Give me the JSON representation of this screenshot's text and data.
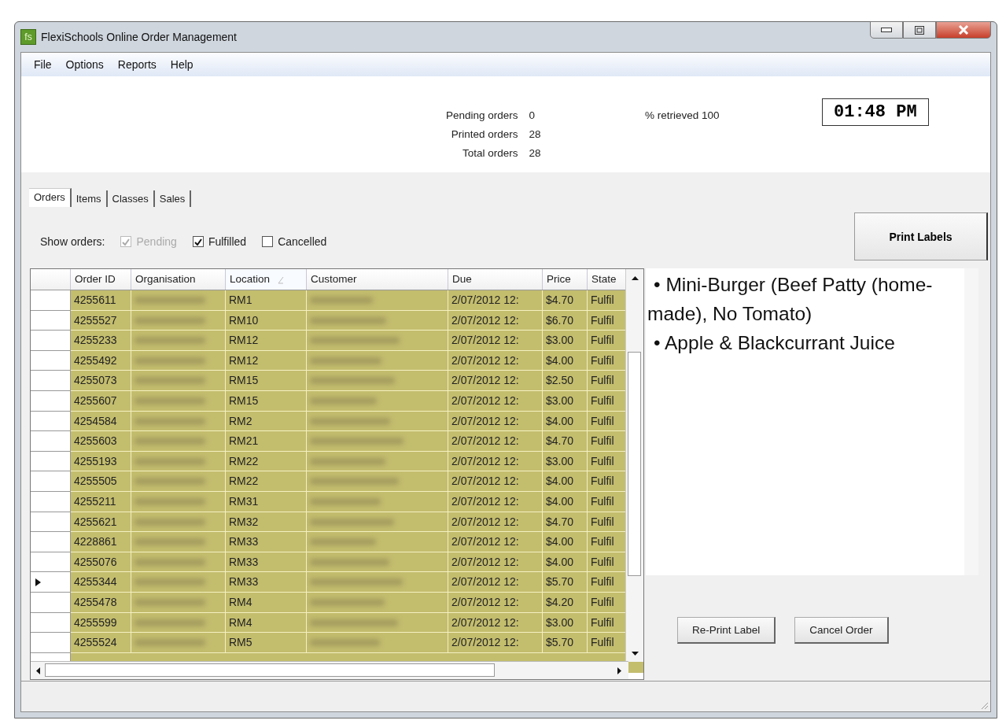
{
  "window": {
    "title": "FlexiSchools Online Order Management",
    "app_icon": "fs"
  },
  "menu": [
    "File",
    "Options",
    "Reports",
    "Help"
  ],
  "stats": [
    {
      "label": "Pending orders",
      "value": "0"
    },
    {
      "label": "Printed orders",
      "value": "28"
    },
    {
      "label": "Total orders",
      "value": "28"
    }
  ],
  "retrieved": "% retrieved 100",
  "clock": "01:48 PM",
  "tabs": [
    {
      "label": "Orders",
      "selected": true
    },
    {
      "label": "Items",
      "selected": false
    },
    {
      "label": "Classes",
      "selected": false
    },
    {
      "label": "Sales",
      "selected": false
    }
  ],
  "filter": {
    "label": "Show orders:",
    "options": [
      {
        "label": "Pending",
        "checked": true,
        "disabled": true
      },
      {
        "label": "Fulfilled",
        "checked": true,
        "disabled": false
      },
      {
        "label": "Cancelled",
        "checked": false,
        "disabled": false
      }
    ]
  },
  "print_button": "Print Labels",
  "grid": {
    "columns": [
      {
        "label": "Order ID",
        "sorted": false
      },
      {
        "label": "Organisation",
        "sorted": false
      },
      {
        "label": "Location",
        "sorted": true
      },
      {
        "label": "Customer",
        "sorted": false
      },
      {
        "label": "Due",
        "sorted": false
      },
      {
        "label": "Price",
        "sorted": false
      },
      {
        "label": "State",
        "sorted": false
      }
    ],
    "rows": [
      {
        "order_id": "4255611",
        "location": "RM1",
        "due": "2/07/2012 12:",
        "price": "$4.70",
        "state": "Fulfil",
        "selected": false
      },
      {
        "order_id": "4255527",
        "location": "RM10",
        "due": "2/07/2012 12:",
        "price": "$6.70",
        "state": "Fulfil",
        "selected": false
      },
      {
        "order_id": "4255233",
        "location": "RM12",
        "due": "2/07/2012 12:",
        "price": "$3.00",
        "state": "Fulfil",
        "selected": false
      },
      {
        "order_id": "4255492",
        "location": "RM12",
        "due": "2/07/2012 12:",
        "price": "$4.00",
        "state": "Fulfil",
        "selected": false
      },
      {
        "order_id": "4255073",
        "location": "RM15",
        "due": "2/07/2012 12:",
        "price": "$2.50",
        "state": "Fulfil",
        "selected": false
      },
      {
        "order_id": "4255607",
        "location": "RM15",
        "due": "2/07/2012 12:",
        "price": "$3.00",
        "state": "Fulfil",
        "selected": false
      },
      {
        "order_id": "4254584",
        "location": "RM2",
        "due": "2/07/2012 12:",
        "price": "$4.00",
        "state": "Fulfil",
        "selected": false
      },
      {
        "order_id": "4255603",
        "location": "RM21",
        "due": "2/07/2012 12:",
        "price": "$4.70",
        "state": "Fulfil",
        "selected": false
      },
      {
        "order_id": "4255193",
        "location": "RM22",
        "due": "2/07/2012 12:",
        "price": "$3.00",
        "state": "Fulfil",
        "selected": false
      },
      {
        "order_id": "4255505",
        "location": "RM22",
        "due": "2/07/2012 12:",
        "price": "$4.00",
        "state": "Fulfil",
        "selected": false
      },
      {
        "order_id": "4255211",
        "location": "RM31",
        "due": "2/07/2012 12:",
        "price": "$4.00",
        "state": "Fulfil",
        "selected": false
      },
      {
        "order_id": "4255621",
        "location": "RM32",
        "due": "2/07/2012 12:",
        "price": "$4.70",
        "state": "Fulfil",
        "selected": false
      },
      {
        "order_id": "4228861",
        "location": "RM33",
        "due": "2/07/2012 12:",
        "price": "$4.00",
        "state": "Fulfil",
        "selected": false
      },
      {
        "order_id": "4255076",
        "location": "RM33",
        "due": "2/07/2012 12:",
        "price": "$4.00",
        "state": "Fulfil",
        "selected": false
      },
      {
        "order_id": "4255344",
        "location": "RM33",
        "due": "2/07/2012 12:",
        "price": "$5.70",
        "state": "Fulfil",
        "selected": true
      },
      {
        "order_id": "4255478",
        "location": "RM4",
        "due": "2/07/2012 12:",
        "price": "$4.20",
        "state": "Fulfil",
        "selected": false
      },
      {
        "order_id": "4255599",
        "location": "RM4",
        "due": "2/07/2012 12:",
        "price": "$3.00",
        "state": "Fulfil",
        "selected": false
      },
      {
        "order_id": "4255524",
        "location": "RM5",
        "due": "2/07/2012 12:",
        "price": "$5.70",
        "state": "Fulfil",
        "selected": false
      }
    ]
  },
  "detail": {
    "items": [
      "• Mini-Burger (Beef Patty (home-made), No Tomato)",
      "• Apple & Blackcurrant Juice"
    ]
  },
  "buttons": [
    "Re-Print Label",
    "Cancel Order"
  ]
}
